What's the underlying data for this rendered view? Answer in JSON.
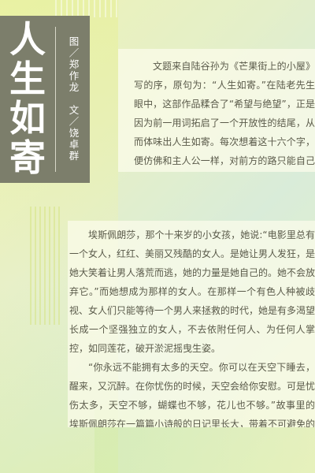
{
  "title": {
    "chars": [
      "人",
      "生",
      "如",
      "寄"
    ],
    "credit": "图／郑作龙　文／饶卓群"
  },
  "intro": {
    "text": "文题来自陆谷孙为《芒果街上的小屋》写的序，原句为：“人生如寄。”在陆老先生眼中，这部作品糅合了“希望与绝望”，正是因为前一用词拓启了一个开放性的结尾，从而体味出人生如寄。每次想着这十六个字，便仿佛和主人公一样，对前方的路只能自己摸索向前，凭着心中那个“回不去”的信念坚定地战斗。"
  },
  "body": {
    "paragraphs": [
      "埃斯佩朗莎，那个十来岁的小女孩，她说:“电影里总有一个女人，红红、美丽又残酷的女人。是她让男人发狂，是她大笑着让男人落荒而逃，她的力量是她自己的。她不会放弃它。”而她想成为那样的女人。在那样一个有色人种被歧视、女人们只能等待一个男人来拯救的时代，她是有多渴望长成一个坚强独立的女人，不去依附任何人、为任何人掌控，如同莲花，破开淤泥摇曳生姿。",
      "“你永远不能拥有太多的天空。你可以在天空下睡去，醒来，又沉醉。在你忧伤的时候，天空会给你安慰。可是忧伤太多，天空不够，蝴蝶也不够，花儿也不够。”故事里的埃斯佩朗莎在一篇篇小诗般的日记里长大，带着不可避免的成长的敏感与伤痛，以及无法言说的少年少的莫名感伤，读起来也有种淡淡的忧愁。"
    ]
  }
}
